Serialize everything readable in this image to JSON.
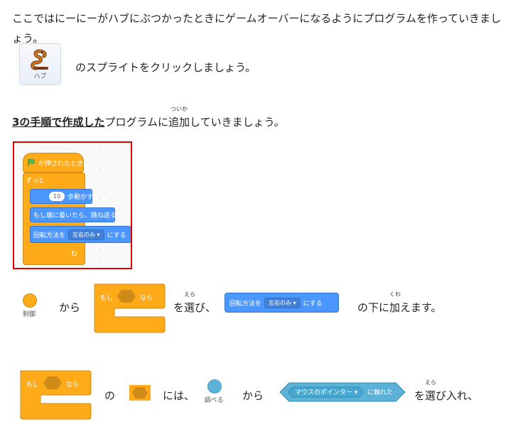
{
  "intro_text": "ここではにーにーがハブにぶつかったときにゲームオーバーになるようにプログラムを作っていきましょう。",
  "sprite": {
    "label": "ハブ",
    "instruction": "のスプライトをクリックしましょう。"
  },
  "step_heading": {
    "link_text": "3の手順で作成した",
    "text_before_ruby": "プログラムに",
    "ruby_base": "追加",
    "ruby_text": "ついか",
    "text_after": "していきましょう。"
  },
  "code": {
    "hat": "が押されたとき",
    "forever": "ずっと",
    "move_value": "10",
    "move_label": "歩動かす",
    "bounce": "もし端に着いたら、跳ね返る",
    "rotation_prefix": "回転方法を",
    "rotation_value": "左右のみ",
    "rotation_suffix": "にする"
  },
  "line1": {
    "category_label": "制御",
    "kara": "から",
    "if_block": {
      "moshi": "もし",
      "nara": "なら"
    },
    "wo": "を",
    "erabi_base": "選",
    "erabi_ruby": "えら",
    "erabi_tail": "び、",
    "rotation_block": {
      "prefix": "回転方法を",
      "value": "左右のみ",
      "suffix": "にする"
    },
    "shita_ni": "の下に",
    "kuwae_base": "加",
    "kuwae_ruby": "くわ",
    "kuwae_tail": "えます。"
  },
  "line2": {
    "if_block": {
      "moshi": "もし",
      "nara": "なら"
    },
    "no": "の",
    "ni_wa": "には、",
    "category_label": "調べる",
    "kara": "から",
    "touching_block": {
      "value": "マウスのポインター",
      "suffix": "に触れた"
    },
    "wo": "を",
    "erabi_base": "選",
    "erabi_ruby": "えら",
    "erabi_tail": "び入れ、"
  },
  "colors": {
    "control": "#ffab19",
    "motion": "#4c97ff",
    "sensing": "#5cb1d6",
    "frame": "#e10000"
  }
}
